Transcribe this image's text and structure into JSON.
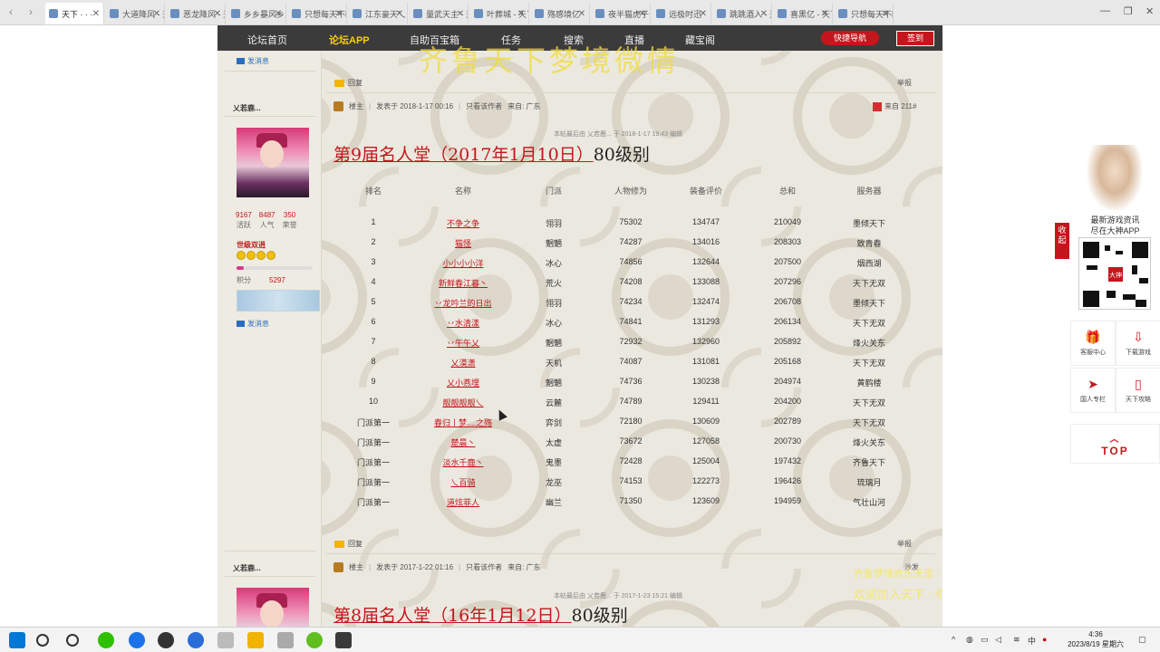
{
  "browser": {
    "tabs": [
      {
        "label": "天下 · · ·",
        "active": true
      },
      {
        "label": "大道降风 - 天下"
      },
      {
        "label": "恶龙降风 - 天"
      },
      {
        "label": "乡乡暴风乡乡"
      },
      {
        "label": "只想每天不睡"
      },
      {
        "label": "江东豪天乀"
      },
      {
        "label": "量武天主 - 天下"
      },
      {
        "label": "叶葬城 - 天下"
      },
      {
        "label": "殇感境亿"
      },
      {
        "label": "夜半猫虎子乀"
      },
      {
        "label": "远极时迅"
      },
      {
        "label": "跳跳酒入 - 天下"
      },
      {
        "label": "喜黑亿 - 天下"
      },
      {
        "label": "只想每天不睡"
      }
    ]
  },
  "nav": {
    "items": [
      "论坛首页",
      "论坛APP",
      "自助百宝箱",
      "任务",
      "搜索",
      "直播",
      "藏宝阁"
    ],
    "quick_nav": "快捷导航",
    "signin": "签到",
    "banner": "齐鲁天下梦境微情"
  },
  "sidebar": {
    "send_msg": "发消息",
    "users": [
      {
        "name": "乂若鹿...",
        "stats": [
          {
            "num": "9167",
            "label": "活跃"
          },
          {
            "num": "8487",
            "label": "人气"
          },
          {
            "num": "350",
            "label": "荣誉"
          }
        ],
        "rank": "世级双逍",
        "stars": 4,
        "level_fill": 0.1,
        "score_label": "积分",
        "score": "5297"
      },
      {
        "name": "乂若鹿..."
      }
    ]
  },
  "post1": {
    "reply": "回复",
    "report": "举报",
    "author": "楼主",
    "posted": "发表于 2018-1-17 00:16",
    "view_author": "只看该作者",
    "source": "来自: 广东",
    "floor": "来自 211#",
    "edit_note": "本帖最后由 乂若鹿... 于 2018-1-17 19:43 编辑",
    "title": "第9届名人堂（2017年1月10日）",
    "title_suffix": "80级别",
    "table": {
      "headers": [
        "排名",
        "名称",
        "门派",
        "人物修为",
        "装备评价",
        "总和",
        "服务器"
      ],
      "rows": [
        [
          "1",
          "不争之争",
          "翎羽",
          "75302",
          "134747",
          "210049",
          "墨倾天下"
        ],
        [
          "2",
          "猫怪",
          "魍魉",
          "74287",
          "134016",
          "208303",
          "致青春"
        ],
        [
          "3",
          "小小小小洋",
          "冰心",
          "74856",
          "132644",
          "207500",
          "烟西湖"
        ],
        [
          "4",
          "新鲜春江暮丶",
          "荒火",
          "74208",
          "133088",
          "207296",
          "天下无双"
        ],
        [
          "5",
          "丷龙吟兰的日出",
          "翎羽",
          "74234",
          "132474",
          "206708",
          "墨倾天下"
        ],
        [
          "6",
          "丷水清漾",
          "冰心",
          "74841",
          "131293",
          "206134",
          "天下无双"
        ],
        [
          "7",
          "丷午午乂",
          "魍魉",
          "72932",
          "132960",
          "205892",
          "烽火关东"
        ],
        [
          "8",
          "乂漠潇",
          "天机",
          "74087",
          "131081",
          "205168",
          "天下无双"
        ],
        [
          "9",
          "乂小燕埋",
          "魍魉",
          "74736",
          "130238",
          "204974",
          "黄鹤楼"
        ],
        [
          "10",
          "靓靓靓靓乀",
          "云麓",
          "74789",
          "129411",
          "204200",
          "天下无双"
        ],
        [
          "门派第一",
          "春归丨梦....之殇",
          "弈剑",
          "72180",
          "130609",
          "202789",
          "天下无双"
        ],
        [
          "门派第一",
          "楚晨丶",
          "太虚",
          "73672",
          "127058",
          "200730",
          "烽火关东"
        ],
        [
          "门派第一",
          "淡水千鹿丶",
          "鬼墨",
          "72428",
          "125004",
          "197432",
          "齐鲁天下"
        ],
        [
          "门派第一",
          "乀百骑",
          "龙巫",
          "74153",
          "122273",
          "196426",
          "琉璃月"
        ],
        [
          "门派第一",
          "道炫菲人",
          "幽兰",
          "71350",
          "123609",
          "194959",
          "气壮山河"
        ]
      ]
    }
  },
  "post2": {
    "reply": "回复",
    "report": "举报",
    "author": "楼主",
    "posted": "发表于 2017-1-22 01:16",
    "view_author": "只看该作者",
    "source": "来自: 广东",
    "floor": "沙发",
    "edit_note": "本帖最后由 乂若鹿... 于 2017-1-23 15:21 编辑",
    "title": "第8届名人堂（16年1月12日）",
    "title_suffix": "80级别",
    "signature_line1": "齐鲁梦境欢乐天堂 · 天下游戏论坛",
    "signature_line2": "欢迎加入天下 · 你我同在一起"
  },
  "right_panel": {
    "collapse": "收起",
    "promo_line1": "最新游戏资讯",
    "promo_line2": "尽在大神APP",
    "qr_logo": "大神",
    "buttons": [
      "客服中心",
      "下载游戏",
      "国人专栏",
      "天下攻略"
    ],
    "top": "TOP"
  },
  "taskbar": {
    "time": "4:36",
    "date": "2023/8/19 星期六",
    "ime": "中"
  }
}
